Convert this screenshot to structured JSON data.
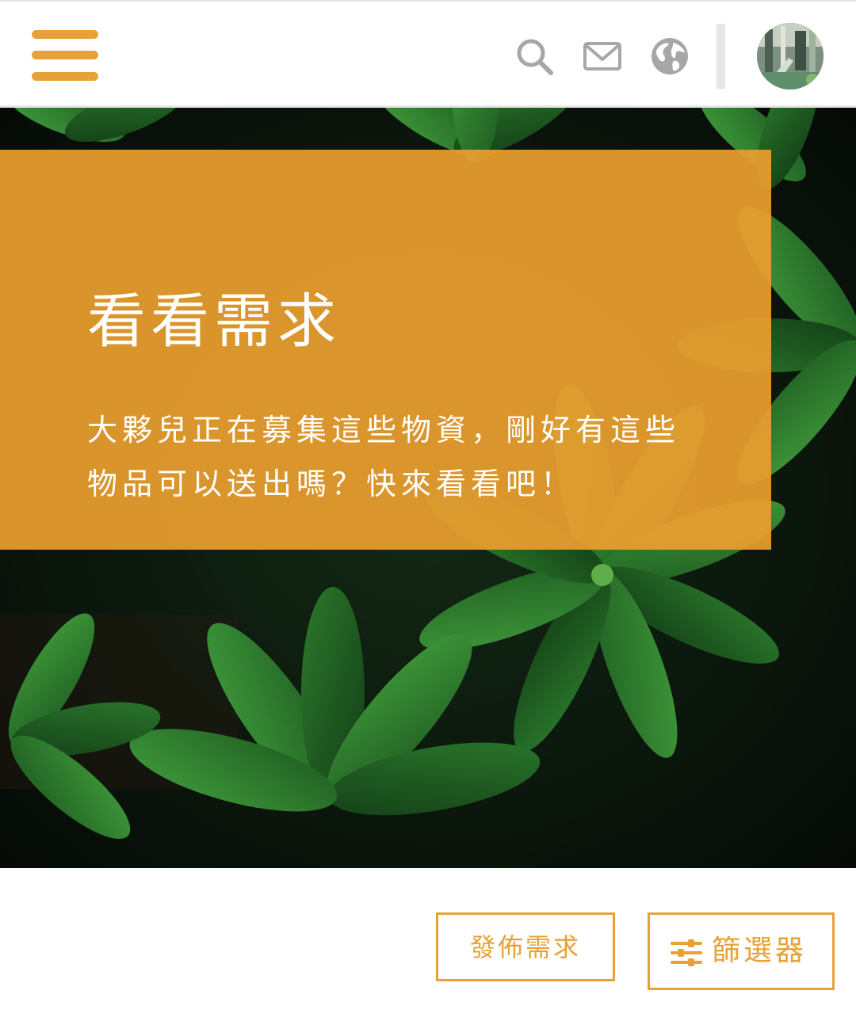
{
  "header": {
    "menu_icon": "hamburger-menu-icon",
    "icons": [
      "search-icon",
      "mail-icon",
      "globe-icon"
    ],
    "avatar_icon": "user-avatar",
    "accent_color": "#e8a137"
  },
  "hero": {
    "title": "看看需求",
    "description": "大夥兒正在募集這些物資，剛好有這些物品可以送出嗎？快來看看吧！",
    "banner_color": "#ea9e2e"
  },
  "actions": {
    "post_request_label": "發佈需求",
    "filter_label": "篩選器",
    "filter_icon": "sliders-icon"
  }
}
